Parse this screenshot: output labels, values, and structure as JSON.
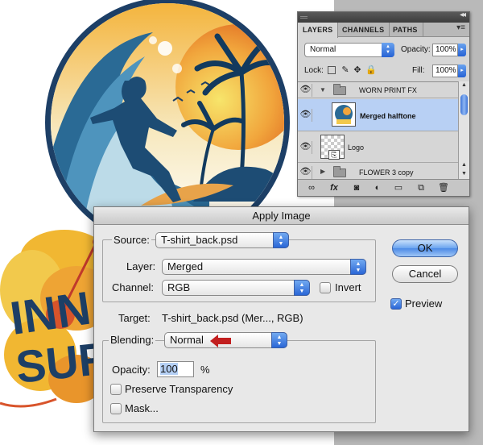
{
  "layers_panel": {
    "tabs": [
      "LAYERS",
      "CHANNELS",
      "PATHS"
    ],
    "blend_mode": "Normal",
    "opacity_label": "Opacity:",
    "opacity_value": "100%",
    "lock_label": "Lock:",
    "fill_label": "Fill:",
    "fill_value": "100%",
    "layers": [
      {
        "name": "WORN PRINT FX",
        "type": "group",
        "expanded": true
      },
      {
        "name": "Merged halftone",
        "type": "layer",
        "selected": true
      },
      {
        "name": "Logo",
        "type": "layer"
      },
      {
        "name": "FLOWER 3 copy",
        "type": "group",
        "expanded": false
      }
    ]
  },
  "dialog": {
    "title": "Apply Image",
    "source_label": "Source:",
    "source_value": "T-shirt_back.psd",
    "layer_label": "Layer:",
    "layer_value": "Merged",
    "channel_label": "Channel:",
    "channel_value": "RGB",
    "invert_label": "Invert",
    "invert_checked": false,
    "target_label": "Target:",
    "target_value": "T-shirt_back.psd (Mer..., RGB)",
    "blending_label": "Blending:",
    "blending_value": "Normal",
    "opacity_label": "Opacity:",
    "opacity_value": "100",
    "opacity_unit": "%",
    "preserve_label": "Preserve Transparency",
    "preserve_checked": false,
    "mask_label": "Mask...",
    "mask_checked": false,
    "ok_label": "OK",
    "cancel_label": "Cancel",
    "preview_label": "Preview",
    "preview_checked": true
  },
  "artwork": {
    "logo_text_line1": "INN",
    "logo_text_line2": "SUR"
  },
  "colors": {
    "accent_blue": "#3d74d8",
    "selection": "#b8d0f4",
    "navy": "#1d3f66",
    "sun_orange": "#e8792a",
    "sun_yellow": "#f5d55a",
    "red_arrow": "#c21f1f"
  }
}
